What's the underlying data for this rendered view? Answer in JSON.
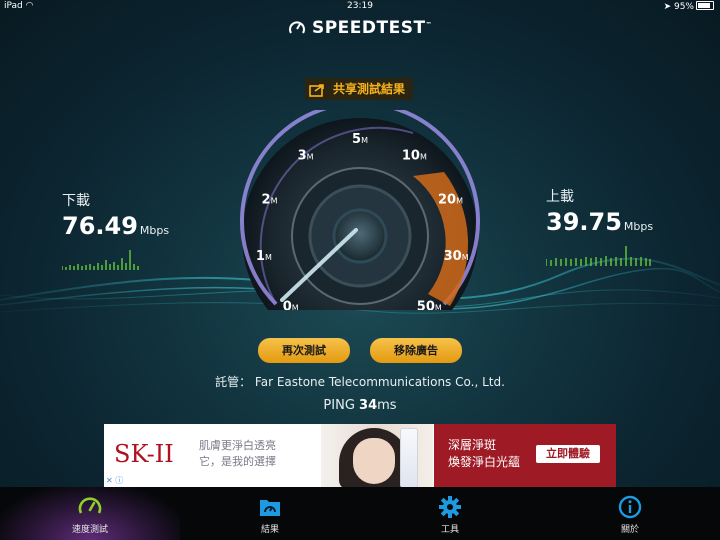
{
  "status_bar": {
    "device": "iPad",
    "time": "23:19",
    "battery": "95%"
  },
  "app": {
    "title": "SPEEDTEST",
    "trademark": "™"
  },
  "share_button": {
    "label": "共享測試結果"
  },
  "download": {
    "label": "下載",
    "value": "76.49",
    "unit": "Mbps"
  },
  "upload": {
    "label": "上載",
    "value": "39.75",
    "unit": "Mbps"
  },
  "gauge": {
    "ticks": [
      "0",
      "1",
      "2",
      "3",
      "5",
      "10",
      "20",
      "30",
      "50"
    ],
    "tick_unit": "M",
    "needle_value": 0
  },
  "buttons": {
    "retest": "再次測試",
    "remove_ads": "移除廣告"
  },
  "host": {
    "label": "託管：",
    "name": "Far Eastone Telecommunications Co., Ltd."
  },
  "ping": {
    "label": "PING",
    "value": "34",
    "unit": "ms"
  },
  "ad": {
    "brand": "SK-II",
    "tagline_1": "肌膚更淨白透亮",
    "tagline_2": "它，是我的選擇",
    "headline_1": "深層淨斑",
    "headline_2": "煥發淨白光蘊",
    "cta": "立即體驗"
  },
  "tabs": [
    {
      "label": "速度測試",
      "icon": "speedometer-icon",
      "active": true
    },
    {
      "label": "結果",
      "icon": "results-folder-icon",
      "active": false
    },
    {
      "label": "工具",
      "icon": "gear-icon",
      "active": false
    },
    {
      "label": "關於",
      "icon": "info-icon",
      "active": false
    }
  ],
  "colors": {
    "accent": "#f6b21c",
    "active_tab": "#8fd12a",
    "icon_blue": "#1e9be0",
    "upload_band": "#d06a1a"
  }
}
